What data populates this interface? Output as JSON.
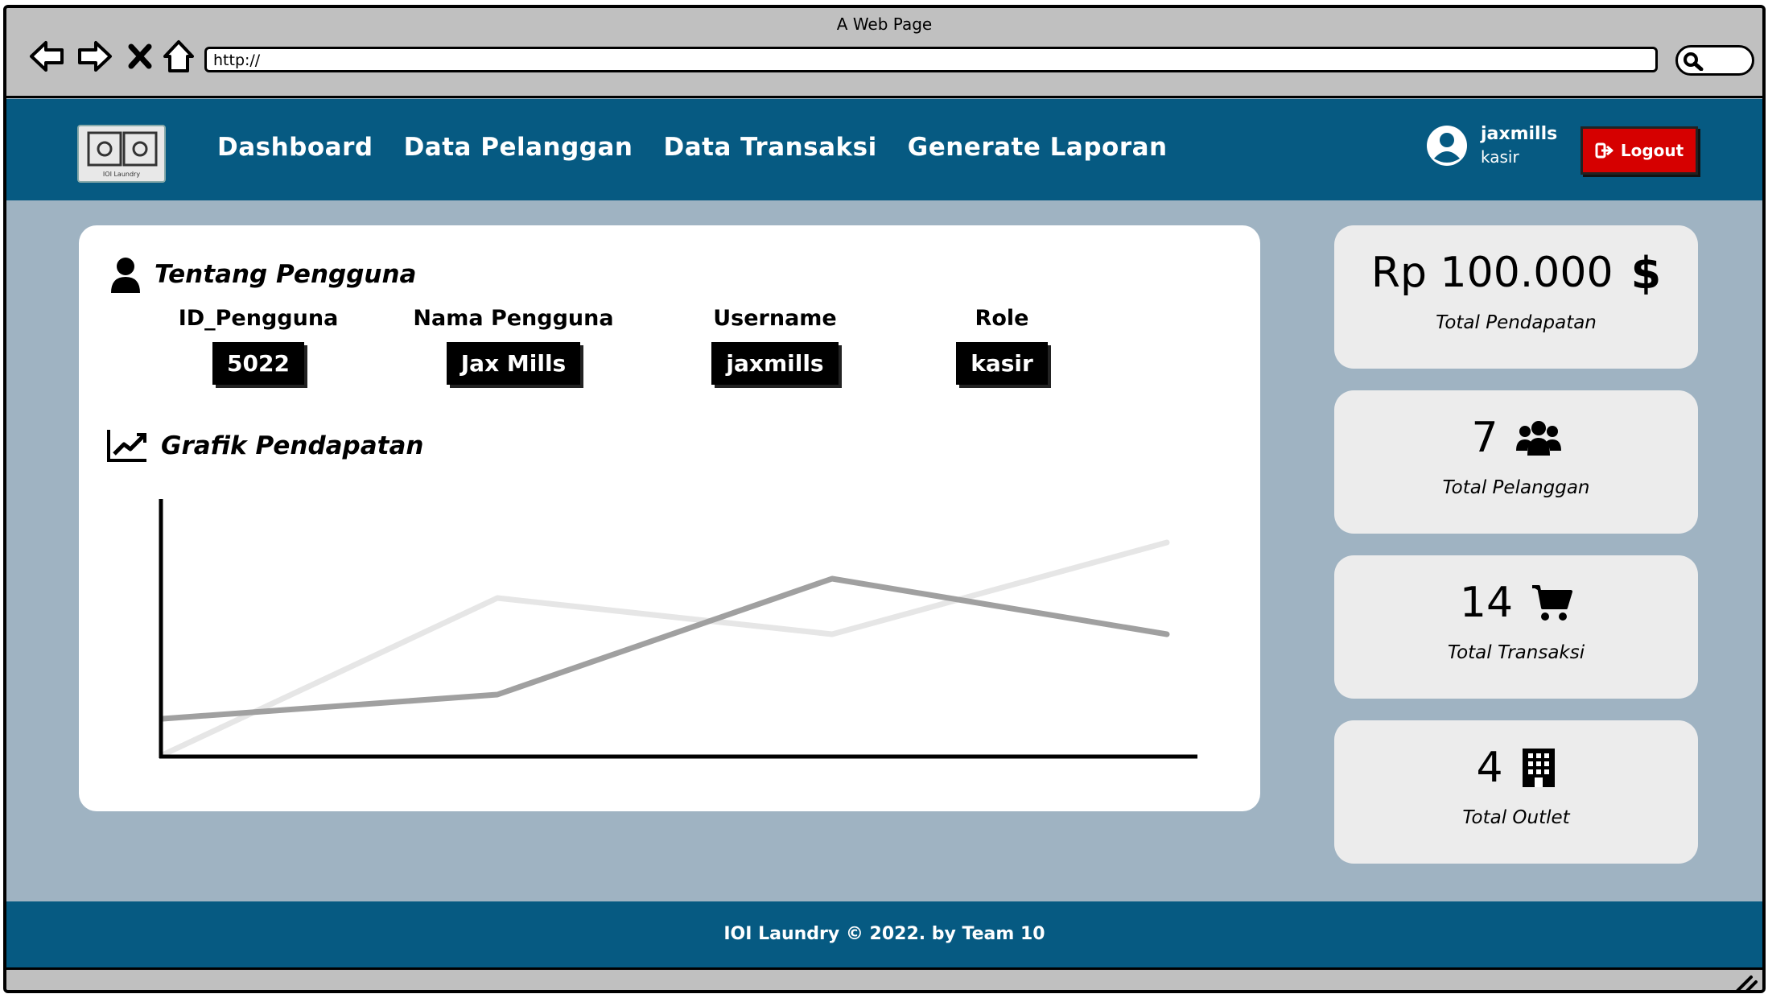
{
  "browser": {
    "window_title": "A Web Page",
    "url": "http://"
  },
  "navbar": {
    "logo_text": "IOI Laundry",
    "links": [
      "Dashboard",
      "Data Pelanggan",
      "Data Transaksi",
      "Generate Laporan"
    ],
    "user": {
      "name": "jaxmills",
      "role": "kasir"
    },
    "logout_label": "Logout",
    "logout_color": "#d60000",
    "bg_color": "#065a82"
  },
  "profile": {
    "title": "Tentang Pengguna",
    "fields": [
      {
        "label": "ID_Pengguna",
        "value": "5022"
      },
      {
        "label": "Nama Pengguna",
        "value": "Jax Mills"
      },
      {
        "label": "Username",
        "value": "jaxmills"
      },
      {
        "label": "Role",
        "value": "kasir"
      }
    ]
  },
  "chart_section": {
    "title": "Grafik Pendapatan"
  },
  "chart_data": {
    "type": "line",
    "x": [
      0,
      1,
      2,
      3
    ],
    "series": [
      {
        "values": [
          15,
          25,
          73,
          50
        ],
        "color": "#a0a0a0"
      },
      {
        "values": [
          0,
          65,
          50,
          88
        ],
        "color": "#e6e6e6"
      }
    ],
    "ylim": [
      0,
      100
    ],
    "title": "",
    "xlabel": "",
    "ylabel": ""
  },
  "stats": [
    {
      "value": "Rp 100.000",
      "label": "Total Pendapatan",
      "icon": "dollar-icon"
    },
    {
      "value": "7",
      "label": "Total Pelanggan",
      "icon": "users-icon"
    },
    {
      "value": "14",
      "label": "Total Transaksi",
      "icon": "cart-icon"
    },
    {
      "value": "4",
      "label": "Total Outlet",
      "icon": "building-icon"
    }
  ],
  "footer": {
    "text": "IOI Laundry © 2022. by Team 10"
  }
}
